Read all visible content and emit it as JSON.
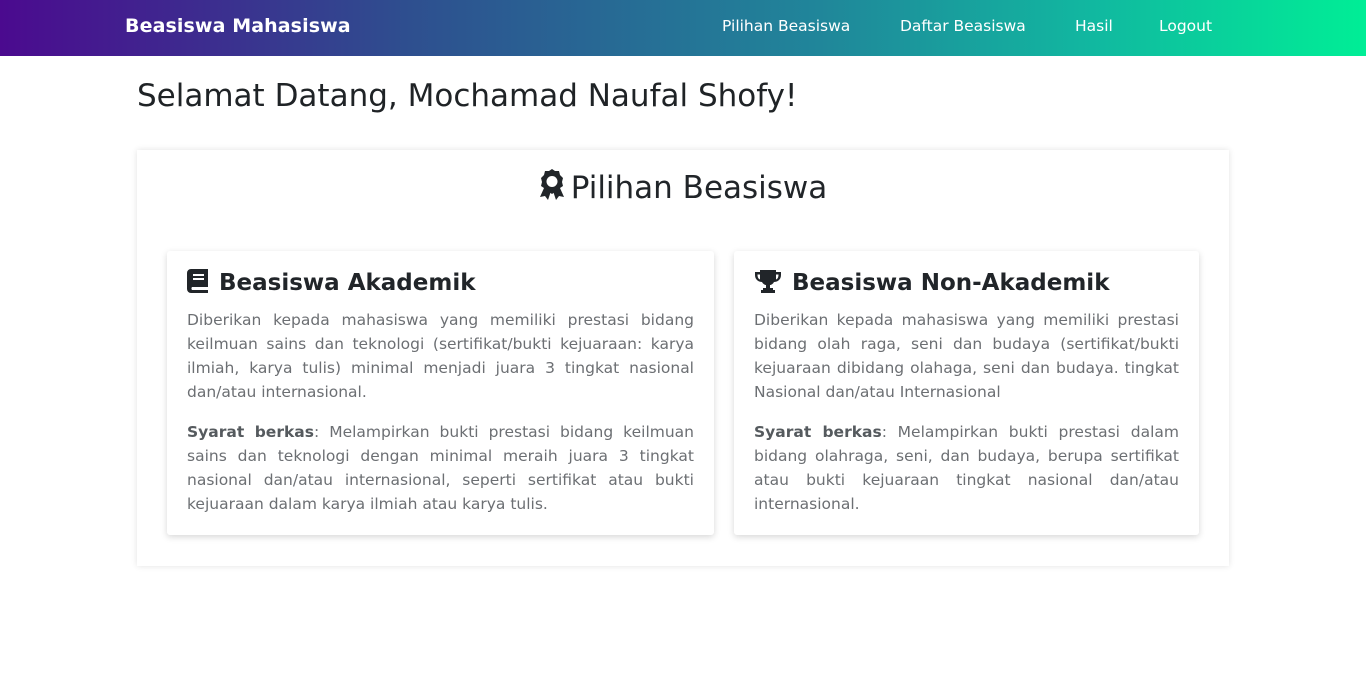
{
  "navbar": {
    "brand": "Beasiswa Mahasiswa",
    "links": [
      "Pilihan Beasiswa",
      "Daftar Beasiswa",
      "Hasil",
      "Logout"
    ]
  },
  "welcome": "Selamat Datang, Mochamad Naufal Shofy!",
  "section": {
    "title": "Pilihan Beasiswa",
    "icon": "award-icon"
  },
  "cards": [
    {
      "icon": "book-icon",
      "title": "Beasiswa Akademik",
      "description": "Diberikan kepada mahasiswa yang memiliki prestasi bidang keilmuan sains dan teknologi (sertifikat/bukti kejuaraan: karya ilmiah, karya tulis) minimal menjadi juara 3 tingkat nasional dan/atau internasional.",
      "req_label": "Syarat berkas",
      "req_text": ": Melampirkan bukti prestasi bidang keilmuan sains dan teknologi dengan minimal meraih juara 3 tingkat nasional dan/atau internasional, seperti sertifikat atau bukti kejuaraan dalam karya ilmiah atau karya tulis."
    },
    {
      "icon": "trophy-icon",
      "title": "Beasiswa Non-Akademik",
      "description": "Diberikan kepada mahasiswa yang memiliki prestasi bidang olah raga, seni dan budaya (sertifikat/bukti kejuaraan dibidang olahaga, seni dan budaya. tingkat Nasional dan/atau Internasional",
      "req_label": "Syarat berkas",
      "req_text": ": Melampirkan bukti prestasi dalam bidang olahraga, seni, dan budaya, berupa sertifikat atau bukti kejuaraan tingkat nasional dan/atau internasional."
    }
  ]
}
